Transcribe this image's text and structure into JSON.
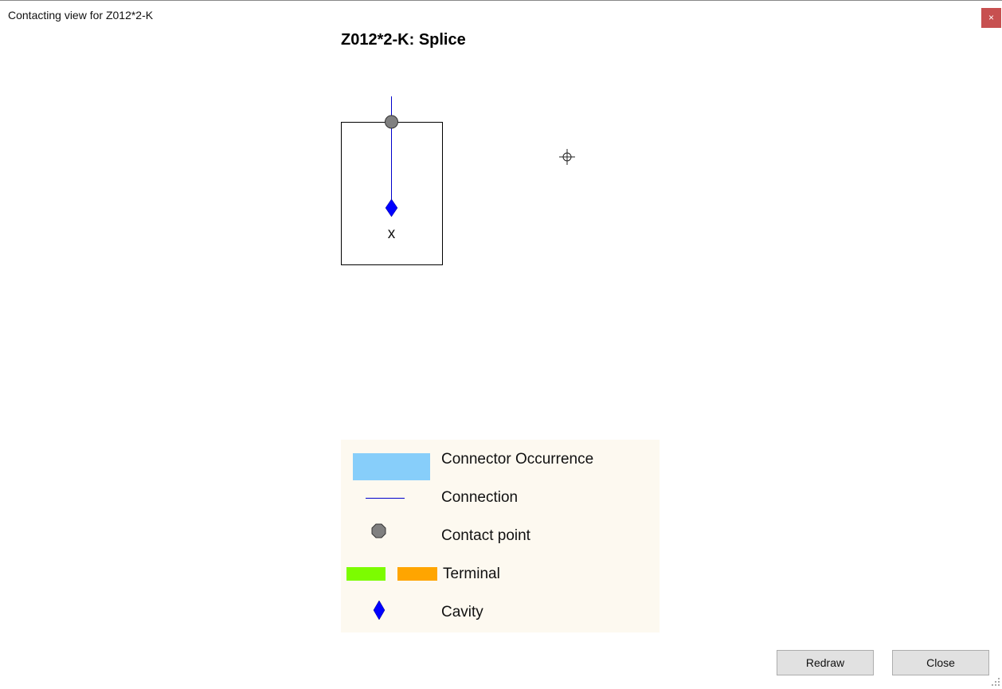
{
  "window": {
    "title": "Contacting view for Z012*2-K",
    "close_glyph": "×"
  },
  "diagram": {
    "title": "Z012*2-K: Splice",
    "cavity_label": "x",
    "connector_color": "#000000",
    "connection_color": "#0000cc",
    "contact_point_color": "#808080",
    "cavity_color": "#0000ff"
  },
  "legend": {
    "items": [
      {
        "label": "Connector Occurrence",
        "icon": "connector-swatch",
        "color": "#87cefa"
      },
      {
        "label": "Connection",
        "icon": "connection-line",
        "color": "#0000cc"
      },
      {
        "label": "Contact point",
        "icon": "contact-point-dot",
        "color": "#808080"
      },
      {
        "label": "Terminal",
        "icon": "terminal-swatches",
        "colors": [
          "#7cfc00",
          "#ffa500"
        ]
      },
      {
        "label": "Cavity",
        "icon": "cavity-diamond",
        "color": "#0000ff"
      }
    ]
  },
  "buttons": {
    "redraw": "Redraw",
    "close": "Close"
  }
}
